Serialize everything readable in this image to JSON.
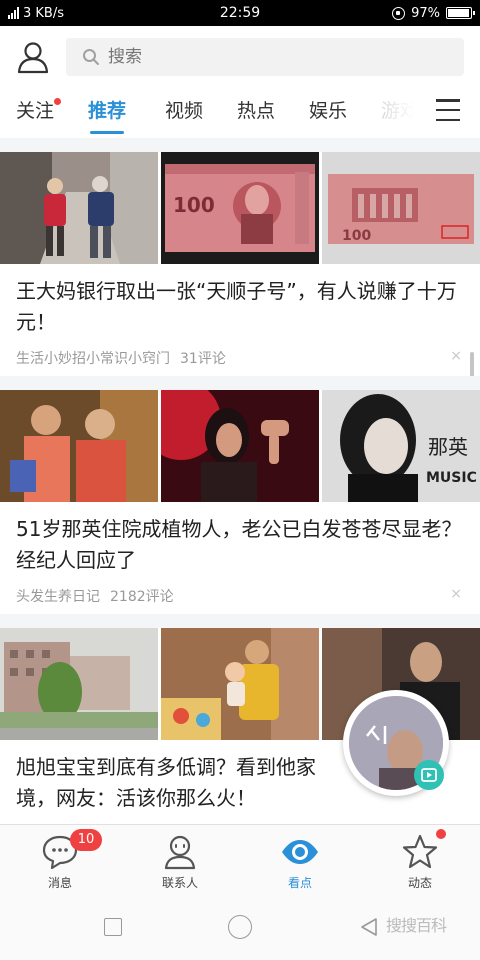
{
  "status_bar": {
    "network": "4G",
    "speed": "3 KB/s",
    "time": "22:59",
    "battery": "97%",
    "battery_level": 0.97
  },
  "header": {
    "search_placeholder": "搜索"
  },
  "tabs": [
    {
      "label": "关注",
      "has_dot": true
    },
    {
      "label": "推荐",
      "active": true
    },
    {
      "label": "视频"
    },
    {
      "label": "热点"
    },
    {
      "label": "娱乐"
    },
    {
      "label": "游戏"
    }
  ],
  "feed": [
    {
      "title": "王大妈银行取出一张“天顺子号”，有人说赚了十万元！",
      "source": "生活小妙招小常识小窍门",
      "comments": "31评论",
      "dismiss": "×"
    },
    {
      "title": "51岁那英住院成植物人，老公已白发苍苍尽显老？经纪人回应了",
      "source": "头发生养日记",
      "comments": "2182评论",
      "dismiss": "×",
      "thumb_text": "那英"
    },
    {
      "title": "旭旭宝宝到底有多低调？看到他家环境，网友：活该你那么火！",
      "title_visible": "旭旭宝宝到底有多低调？看到他家",
      "title_line2": "境，网友：活该你那么火！"
    }
  ],
  "bottom_tabs": [
    {
      "label": "消息",
      "icon": "chat-bubble-icon",
      "badge": "10"
    },
    {
      "label": "联系人",
      "icon": "contacts-icon"
    },
    {
      "label": "看点",
      "icon": "eye-icon",
      "active": true
    },
    {
      "label": "动态",
      "icon": "star-icon",
      "has_dot": true
    }
  ],
  "nav": {
    "watermark": "搜搜百科"
  },
  "colors": {
    "accent": "#2a90d7",
    "badge": "#f04142",
    "meta_gray": "#999999",
    "play_teal": "#2ec1b4"
  }
}
